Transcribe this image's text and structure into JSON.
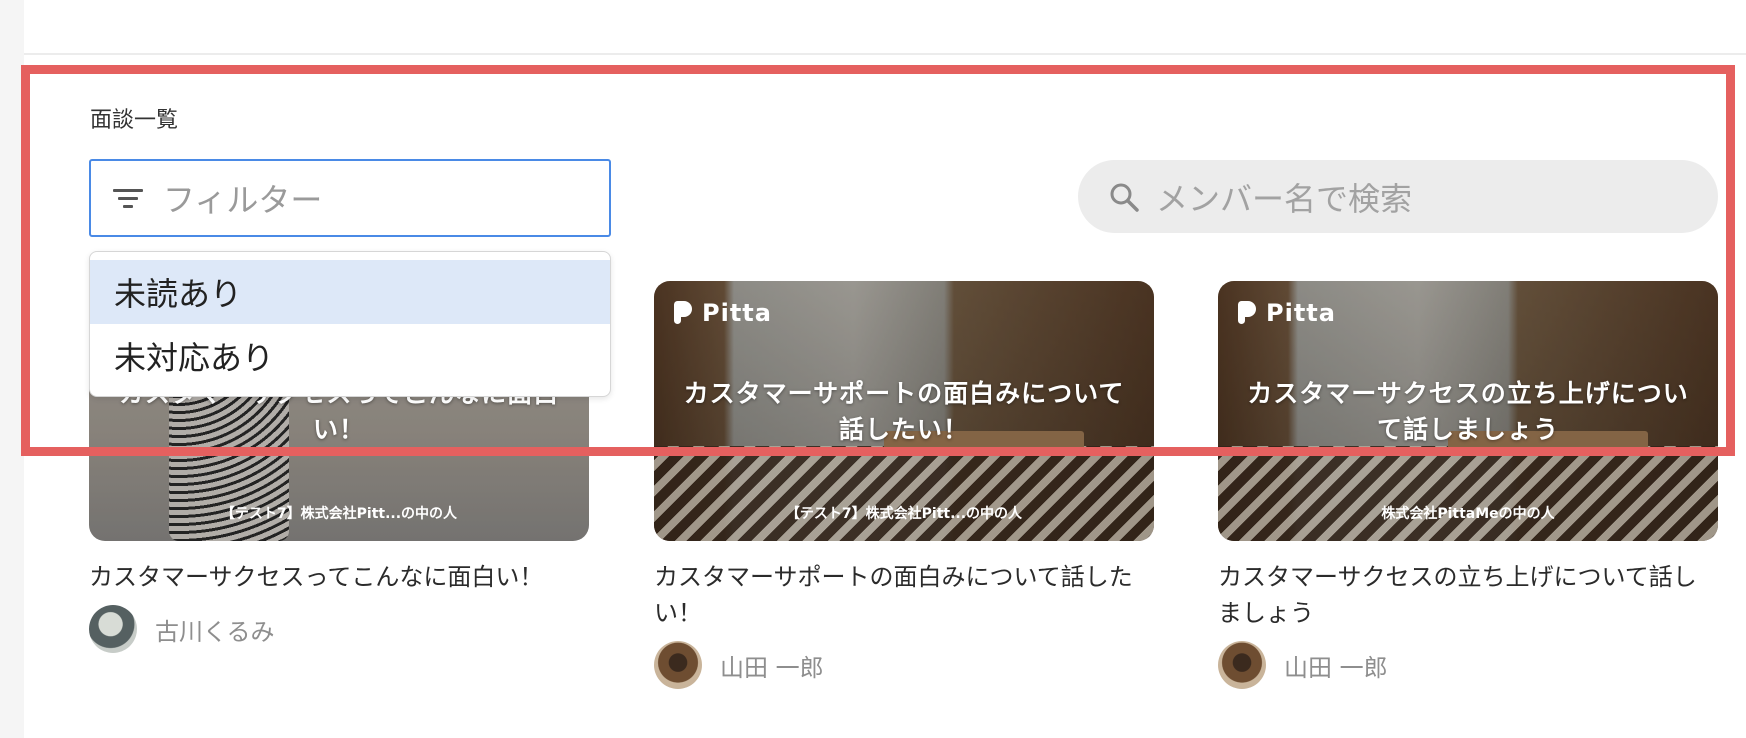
{
  "section": {
    "title": "面談一覧"
  },
  "filter": {
    "placeholder": "フィルター",
    "options": [
      "未読あり",
      "未対応あり"
    ],
    "highlighted_option": "未読あり"
  },
  "search": {
    "placeholder": "メンバー名で検索"
  },
  "cards": [
    {
      "thumb_title": "カスタマーサクセスってこんなに面白い！",
      "company": "【テスト7】株式会社Pitt...の中の人",
      "title": "カスタマーサクセスってこんなに面白い！",
      "author": "古川くるみ"
    },
    {
      "logo": "Pitta",
      "thumb_title": "カスタマーサポートの面白みについて話したい！",
      "company": "【テスト7】株式会社Pitt...の中の人",
      "title": "カスタマーサポートの面白みについて話したい！",
      "author": "山田 一郎"
    },
    {
      "logo": "Pitta",
      "thumb_title": "カスタマーサクセスの立ち上げについて話しましょう",
      "company": "株式会社PittaMeの中の人",
      "title": "カスタマーサクセスの立ち上げについて話しましょう",
      "author": "山田 一郎"
    }
  ],
  "colors": {
    "highlight_border": "#e5605f",
    "focus_border": "#4a8ae6",
    "option_active_bg": "#dde8f8"
  }
}
